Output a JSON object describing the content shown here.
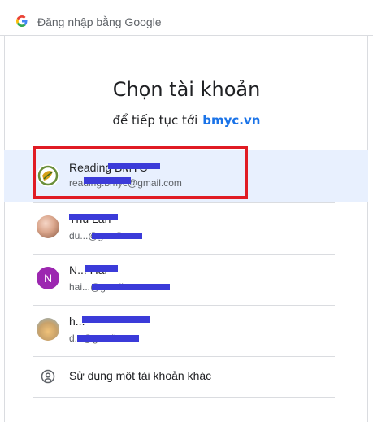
{
  "window": {
    "title": "Đăng nhập bằng Google"
  },
  "main": {
    "heading": "Chọn tài khoản",
    "subheading_prefix": "để tiếp tục tới",
    "subheading_site": "bmyc.vn"
  },
  "accounts": [
    {
      "name": "Reading BMYC",
      "email": "reading.bmyc@gmail.com",
      "avatar": "bmyc-logo-avatar",
      "selected": true
    },
    {
      "name": "Thu Lan",
      "email": "du...@gmail.com",
      "avatar": "photo-avatar"
    },
    {
      "name": "N... Hai",
      "email": "hai...@gmail.com",
      "avatar": "letter-avatar",
      "avatar_letter": "N",
      "avatar_color": "#9c27b0"
    },
    {
      "name": "h...",
      "email": "d...@gmail.com",
      "avatar": "photo-avatar"
    }
  ],
  "other_account": {
    "label": "Sử dụng một tài khoản khác",
    "icon": "account-circle-icon"
  },
  "colors": {
    "accent": "#1a73e8",
    "selected_bg": "#e8f0fe",
    "highlight_border": "#e01b24",
    "redaction": "#3b3bd9"
  }
}
